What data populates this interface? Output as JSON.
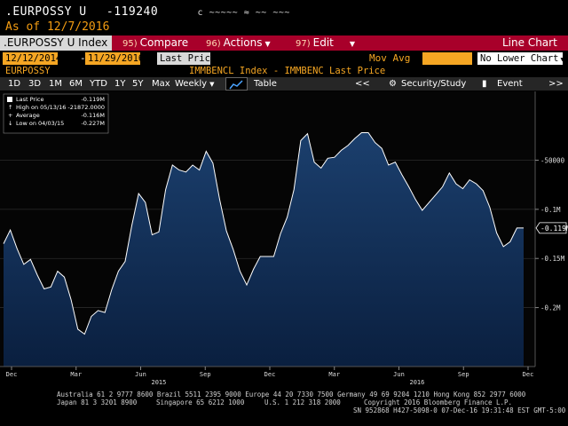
{
  "header": {
    "ticker": ".EURPOSSY U",
    "value": "-119240",
    "scrambled": "c ~~~~~ ≈   ~~ ~~~",
    "as_of": "As of 12/7/2016"
  },
  "menubar": {
    "index_name": ".EURPOSSY U Index",
    "compare_num": "95)",
    "compare": "Compare",
    "actions_num": "96)",
    "actions": "Actions",
    "edit_num": "97)",
    "edit": "Edit",
    "chart_type": "Line Chart"
  },
  "range": {
    "start": "12/12/2014",
    "dash": "-",
    "end": "11/29/2016",
    "field": "Last Price",
    "study_label": "Mov Avg",
    "lower_chart": "No Lower Chart"
  },
  "legend_top": {
    "left": "EURPOSSY",
    "center": "IMMBENCL Index - IMMBENC  Last Price"
  },
  "toolbar": {
    "periods": [
      "1D",
      "3D",
      "1M",
      "6M",
      "YTD",
      "1Y",
      "5Y",
      "Max"
    ],
    "frequency": "Weekly",
    "table": "Table",
    "nav_left": "<<",
    "security_study": "Security/Study",
    "event": "Event",
    "nav_right": ">>"
  },
  "icons": {
    "chevron_down": "chevron-down-icon",
    "line_chart": "line-chart-icon",
    "gear": "gear-icon",
    "event": "event-icon"
  },
  "colors": {
    "red_bar": "#a8002a",
    "orange": "#f5a623",
    "area_fill": "#0f2e55",
    "line": "#ffffff"
  },
  "chart_data": {
    "type": "area",
    "series_name": "Last Price",
    "legend": [
      {
        "label": "Last Price",
        "value": "-0.119M"
      },
      {
        "label": "High on 05/13/16",
        "value": "-21872.0000"
      },
      {
        "label": "Average",
        "value": "-0.116M"
      },
      {
        "label": "Low on 04/03/15",
        "value": "-0.227M"
      }
    ],
    "last_value_label": "-0.119M",
    "ylim": [
      -0.26,
      0.02
    ],
    "y_ticks": [
      {
        "label": "-50000",
        "value": -0.05
      },
      {
        "label": "-0.1M",
        "value": -0.1
      },
      {
        "label": "-0.15M",
        "value": -0.15
      },
      {
        "label": "-0.2M",
        "value": -0.2
      }
    ],
    "x_month_labels": [
      "Dec",
      "Mar",
      "Jun",
      "Sep",
      "Dec",
      "Mar",
      "Jun",
      "Sep",
      "Dec"
    ],
    "x_year_labels": [
      "2015",
      "2016"
    ],
    "values": [
      -0.135,
      -0.121,
      -0.14,
      -0.156,
      -0.151,
      -0.167,
      -0.181,
      -0.179,
      -0.163,
      -0.169,
      -0.192,
      -0.222,
      -0.227,
      -0.209,
      -0.203,
      -0.205,
      -0.182,
      -0.163,
      -0.153,
      -0.116,
      -0.084,
      -0.093,
      -0.126,
      -0.123,
      -0.08,
      -0.055,
      -0.06,
      -0.062,
      -0.055,
      -0.06,
      -0.041,
      -0.053,
      -0.09,
      -0.122,
      -0.141,
      -0.163,
      -0.177,
      -0.161,
      -0.148,
      -0.148,
      -0.148,
      -0.125,
      -0.108,
      -0.08,
      -0.03,
      -0.023,
      -0.052,
      -0.058,
      -0.048,
      -0.047,
      -0.04,
      -0.035,
      -0.028,
      -0.022,
      -0.022,
      -0.032,
      -0.038,
      -0.055,
      -0.052,
      -0.065,
      -0.077,
      -0.09,
      -0.101,
      -0.093,
      -0.085,
      -0.077,
      -0.063,
      -0.074,
      -0.079,
      -0.07,
      -0.074,
      -0.081,
      -0.098,
      -0.124,
      -0.138,
      -0.133,
      -0.119,
      -0.119
    ]
  },
  "footer": {
    "line1": "Australia 61 2 9777 8600 Brazil 5511 2395 9000 Europe 44 20 7330 7500 Germany 49 69 9204 1210 Hong Kong 852 2977 6000",
    "line2a": "Japan 81 3 3201 8900",
    "line2b": "Singapore 65 6212 1000",
    "line2c": "U.S. 1 212 318 2000",
    "line2d": "Copyright 2016 Bloomberg Finance L.P.",
    "line3": "SN 952868 H427-5098-0 07-Dec-16 19:31:48 EST  GMT-5:00"
  }
}
